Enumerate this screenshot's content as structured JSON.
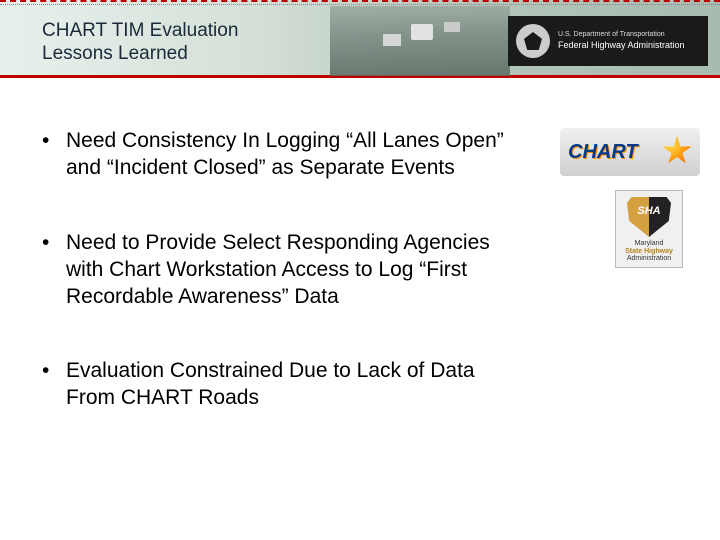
{
  "header": {
    "title_line1": "CHART TIM Evaluation",
    "title_line2": "Lessons Learned",
    "agency_line1": "U.S. Department of Transportation",
    "agency_line2": "Federal Highway Administration"
  },
  "bullets": [
    "Need Consistency In Logging “All Lanes Open” and “Incident Closed” as Separate Events",
    "Need to Provide Select Responding Agencies with Chart Workstation Access to Log “First Recordable Awareness” Data",
    "Evaluation Constrained Due to Lack of Data From CHART Roads"
  ],
  "logos": {
    "chart_label": "CHART",
    "sha_line1": "Maryland",
    "sha_line2": "State Highway",
    "sha_line3": "Administration"
  }
}
